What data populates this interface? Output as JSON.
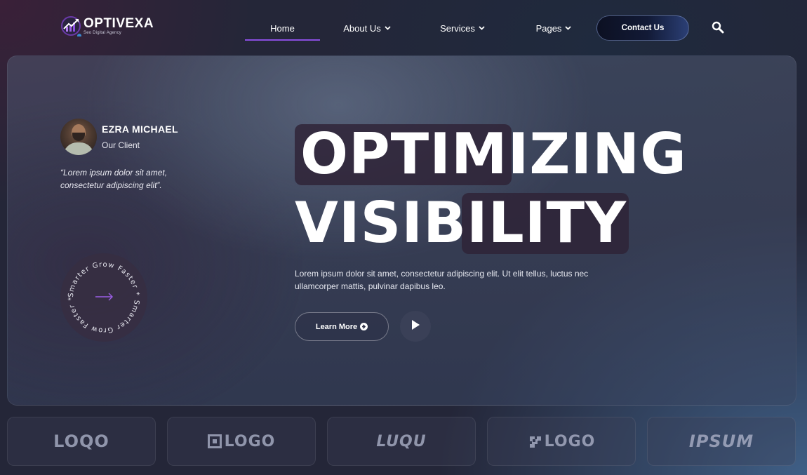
{
  "brand": {
    "name": "OPTIVEXA",
    "tagline": "Seo Digital Agency",
    "accent": "#8a4ee0"
  },
  "nav": {
    "items": [
      {
        "label": "Home",
        "active": true
      },
      {
        "label": "About Us",
        "dropdown": true
      },
      {
        "label": "Services",
        "dropdown": true
      },
      {
        "label": "Pages",
        "dropdown": true
      }
    ],
    "contact_label": "Contact Us"
  },
  "client": {
    "name": "EZRA MICHAEL",
    "role": "Our Client",
    "quote": "“Lorem ipsum dolor sit amet, consectetur adipiscing elit”."
  },
  "badge": {
    "ring_text": "Smarter Grow Faster * Smarter Grow Faster *"
  },
  "hero": {
    "headline_line1": "OPTIMIZING",
    "headline_line2": "VISIBILITY",
    "description": "Lorem ipsum dolor sit amet, consectetur adipiscing elit. Ut elit tellus, luctus nec ullamcorper mattis, pulvinar dapibus leo.",
    "learn_more_label": "Learn More"
  },
  "partners": [
    {
      "text": "LOQO"
    },
    {
      "text": "LOGO"
    },
    {
      "text": "LUQU"
    },
    {
      "text": "LOGO"
    },
    {
      "text": "IPSUM"
    }
  ]
}
